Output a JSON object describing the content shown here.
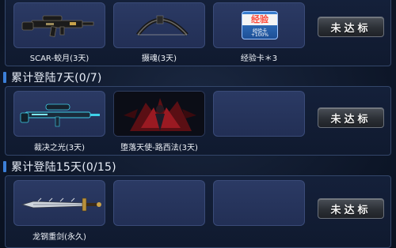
{
  "groups": [
    {
      "title": "",
      "items": [
        {
          "label": "SCAR-蛟月(3天)",
          "icon": "assault-rifle-icon"
        },
        {
          "label": "摄魂(3天)",
          "icon": "bow-icon"
        },
        {
          "label": "经验卡＊3",
          "icon": "exp-card-icon",
          "card_title": "经验",
          "card_sub": "经验卡",
          "card_pct": "+100%"
        }
      ],
      "button": "未达标"
    },
    {
      "title": "累计登陆7天(0/7)",
      "items": [
        {
          "label": "裁决之光(3天)",
          "icon": "sniper-rifle-icon"
        },
        {
          "label": "堕落天使-路西法(3天)",
          "icon": "fallen-angel-character-icon"
        },
        {
          "label": "",
          "icon": "empty-slot"
        }
      ],
      "button": "未达标"
    },
    {
      "title": "累计登陆15天(0/15)",
      "items": [
        {
          "label": "龙钢重剑(永久)",
          "icon": "greatsword-icon"
        },
        {
          "label": "",
          "icon": "empty-slot"
        },
        {
          "label": "",
          "icon": "empty-slot"
        }
      ],
      "button": "未达标"
    }
  ],
  "colors": {
    "accent": "#3c7fd8",
    "slot": "#2b3a64",
    "panel_border": "#33466a",
    "button": "#2c3036"
  }
}
